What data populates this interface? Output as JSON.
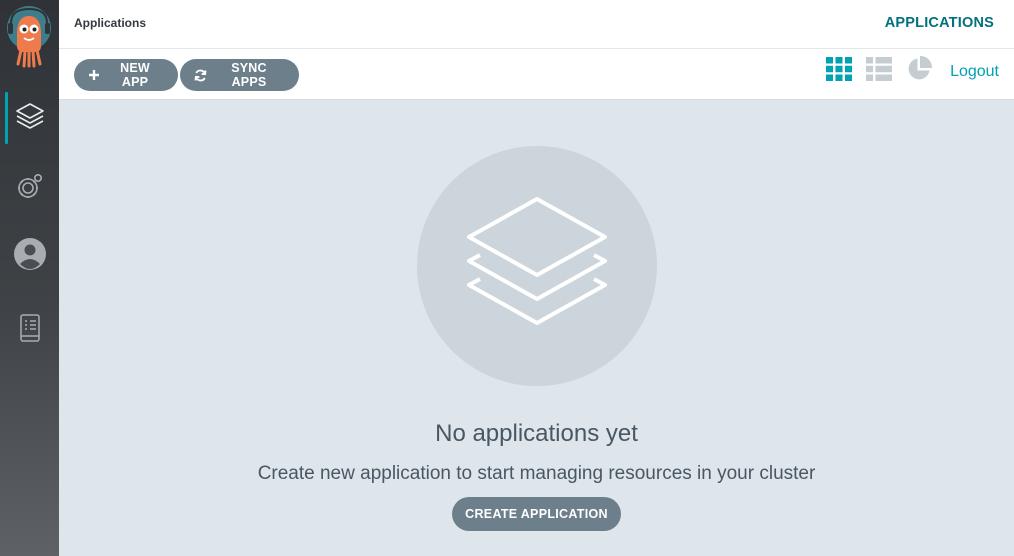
{
  "header": {
    "breadcrumb": "Applications",
    "title": "APPLICATIONS"
  },
  "toolbar": {
    "new_app_label": "NEW APP",
    "sync_apps_label": "SYNC APPS",
    "logout_label": "Logout",
    "view_modes": [
      "tiles-view-icon",
      "list-view-icon",
      "summary-view-icon"
    ],
    "active_view": "tiles-view-icon"
  },
  "sidebar": {
    "items": [
      {
        "name": "applications",
        "icon": "layers-icon",
        "active": true
      },
      {
        "name": "settings",
        "icon": "gear-icon",
        "active": false
      },
      {
        "name": "user-info",
        "icon": "user-icon",
        "active": false
      },
      {
        "name": "documentation",
        "icon": "docs-icon",
        "active": false
      }
    ]
  },
  "empty_state": {
    "title": "No applications yet",
    "subtitle": "Create new application to start managing resources in your cluster",
    "button_label": "CREATE APPLICATION"
  },
  "colors": {
    "accent": "#00a2b3",
    "button": "#6d7f8b",
    "sidebar": "#3a3d41",
    "background": "#dee6eb"
  }
}
